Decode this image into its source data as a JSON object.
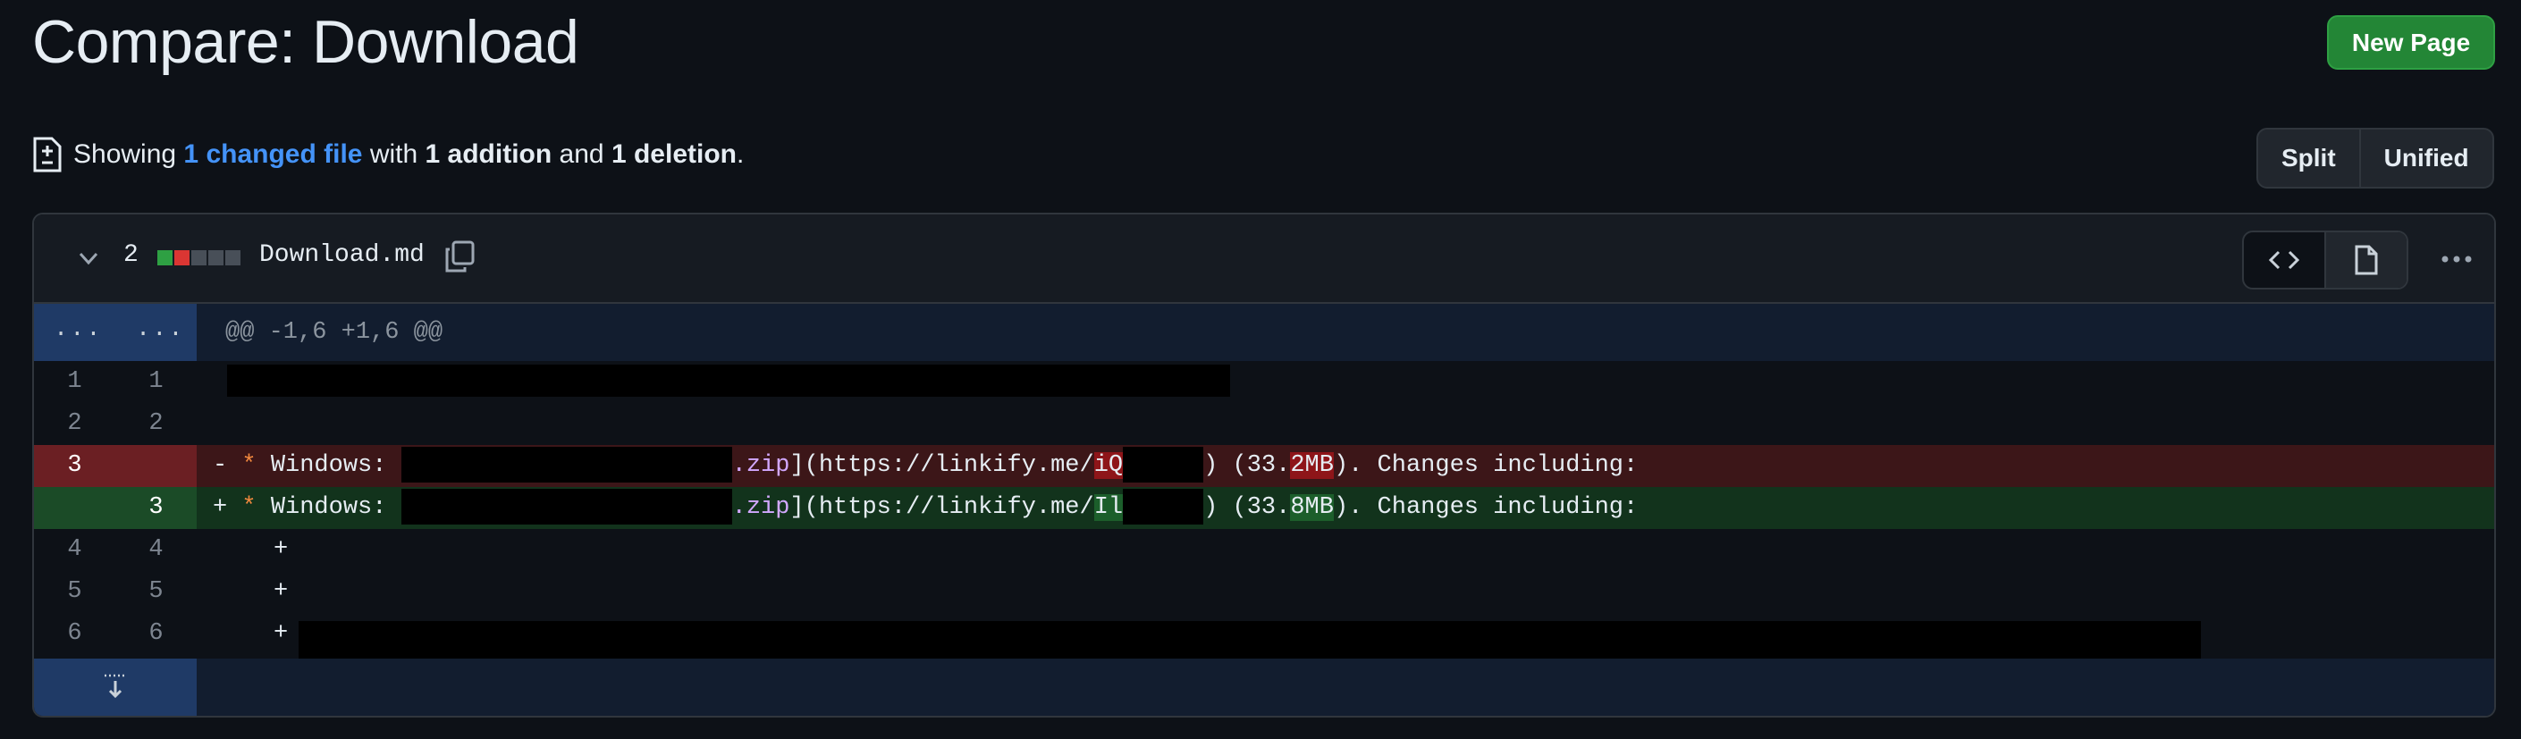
{
  "page": {
    "title": "Compare: Download",
    "new_page_label": "New Page"
  },
  "summary": {
    "prefix": "Showing",
    "changed_files": "1 changed file",
    "with": "with",
    "additions": "1 addition",
    "and": "and",
    "deletions": "1 deletion",
    "suffix": "."
  },
  "view_toggle": {
    "split": "Split",
    "unified": "Unified"
  },
  "file": {
    "change_count": "2",
    "name": "Download.md",
    "diffstat": [
      "#2ea043",
      "#da3633",
      "#484f58",
      "#484f58",
      "#484f58"
    ]
  },
  "diff": {
    "hunk_header": "@@ -1,6 +1,6 @@",
    "hunk_dots_left": "...",
    "hunk_dots_right": "...",
    "lines": {
      "l1": {
        "old": "1",
        "new": "1"
      },
      "l2": {
        "old": "2",
        "new": "2"
      },
      "del": {
        "old": "3",
        "sign": "-",
        "star": "*",
        "label": "Windows:",
        "ext": ".zip",
        "url_prefix": "](https://linkify.me/",
        "url_hl": "iQ",
        "size_open": ") (33.",
        "size_hl": "2MB",
        "rest": "). Changes including:"
      },
      "add": {
        "new": "3",
        "sign": "+",
        "star": "*",
        "label": "Windows:",
        "ext": ".zip",
        "url_prefix": "](https://linkify.me/",
        "url_hl": "Il",
        "size_open": ") (33.",
        "size_hl": "8MB",
        "rest": "). Changes including:"
      },
      "l4": {
        "old": "4",
        "new": "4",
        "plus": "+"
      },
      "l5": {
        "old": "5",
        "new": "5",
        "plus": "+"
      },
      "l6": {
        "old": "6",
        "new": "6",
        "plus": "+"
      }
    }
  }
}
